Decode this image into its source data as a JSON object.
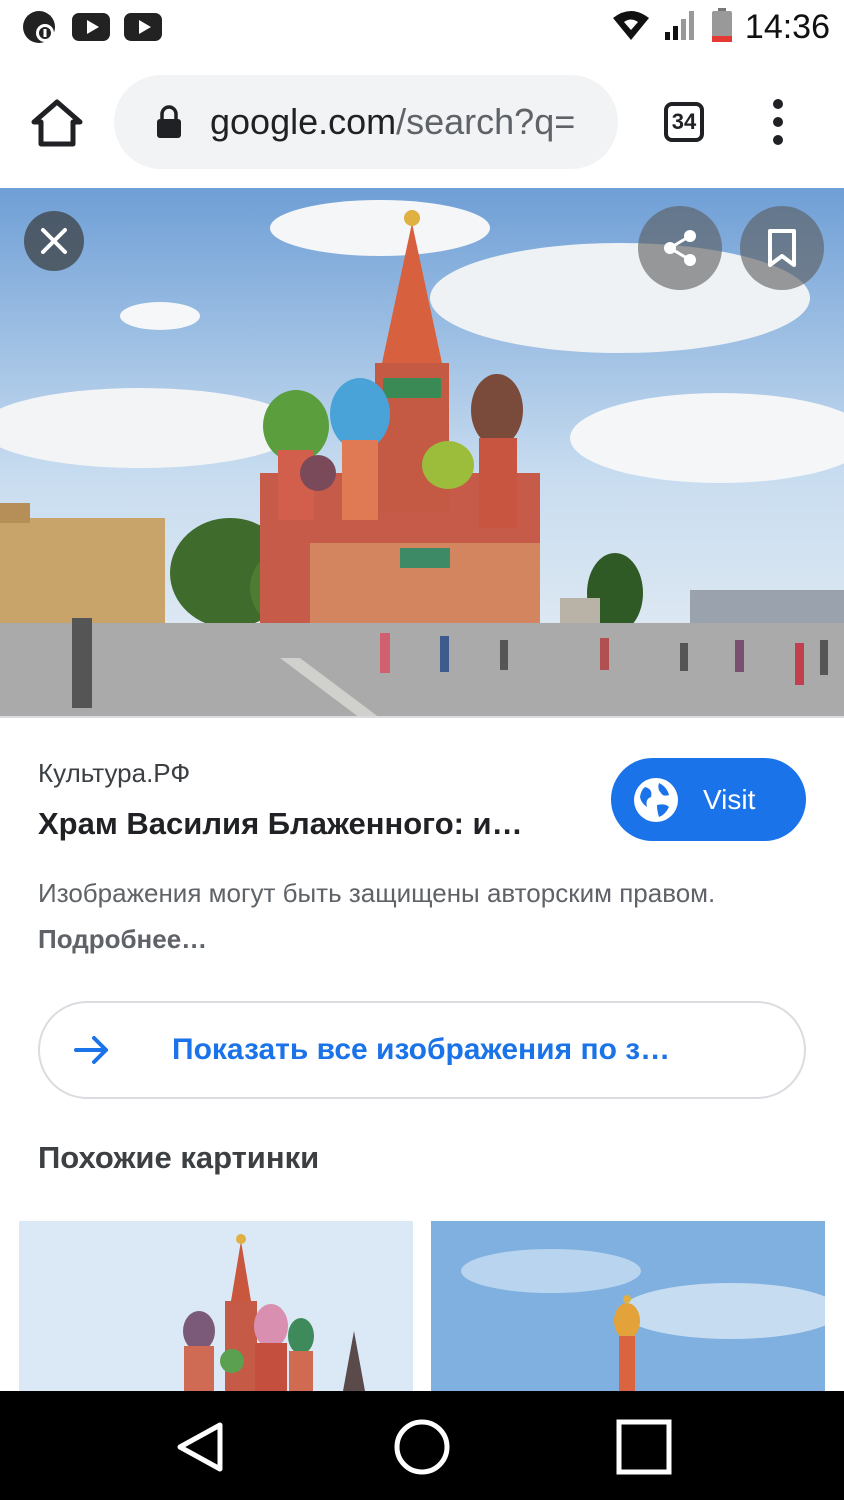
{
  "status_bar": {
    "time": "14:36",
    "icons": [
      "settings-notification-icon",
      "youtube-icon",
      "youtube-icon",
      "wifi-icon",
      "signal-icon",
      "battery-low-icon"
    ]
  },
  "toolbar": {
    "url_domain": "google.com",
    "url_path": "/search?q=",
    "tab_count": "34",
    "icons": [
      "home-icon",
      "lock-icon",
      "more-vert-icon"
    ]
  },
  "image_panel": {
    "icons": [
      "close-icon",
      "share-icon",
      "bookmark-icon"
    ]
  },
  "result": {
    "source": "Культура.РФ",
    "title": "Храм Василия Блаженного: и…",
    "visit_label": "Visit",
    "copyright_text": "Изображения могут быть защищены авторским правом.",
    "more_link": "Подробнее…"
  },
  "show_all": {
    "label": "Показать все изображения по з…"
  },
  "similar": {
    "heading": "Похожие картинки"
  },
  "nav_bar": {
    "icons": [
      "back-icon",
      "home-circle-icon",
      "recents-icon"
    ]
  },
  "colors": {
    "accent": "#1a73e8",
    "omnibox_bg": "#f1f3f4",
    "nav_bg": "#000000"
  }
}
